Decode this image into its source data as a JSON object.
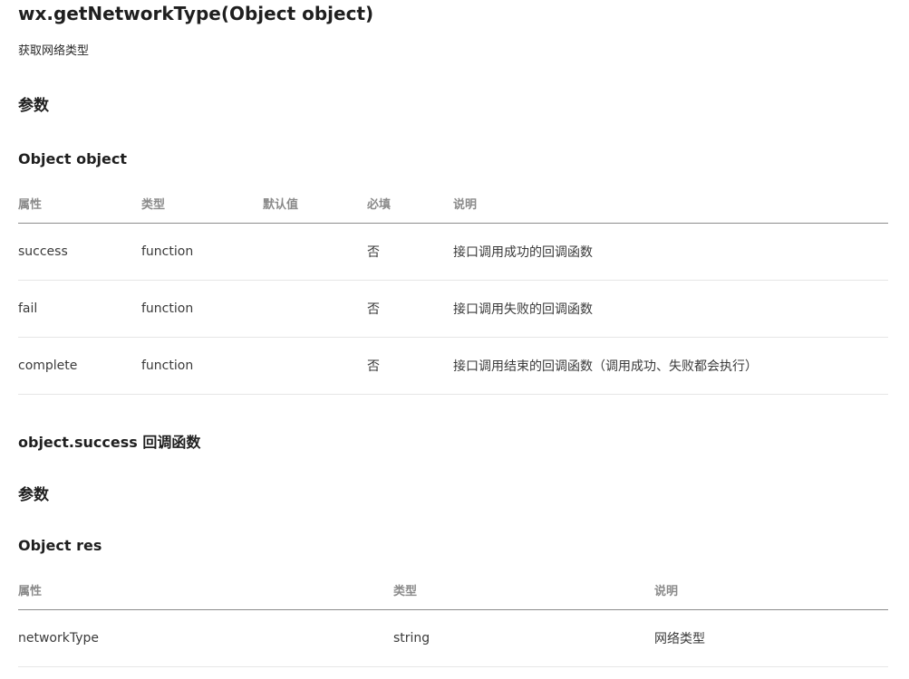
{
  "title": "wx.getNetworkType(Object object)",
  "description": "获取网络类型",
  "params_heading": "参数",
  "object_heading": "Object object",
  "object_table": {
    "headers": [
      "属性",
      "类型",
      "默认值",
      "必填",
      "说明"
    ],
    "rows": [
      {
        "name": "success",
        "type": "function",
        "default": "",
        "required": "否",
        "desc": "接口调用成功的回调函数"
      },
      {
        "name": "fail",
        "type": "function",
        "default": "",
        "required": "否",
        "desc": "接口调用失败的回调函数"
      },
      {
        "name": "complete",
        "type": "function",
        "default": "",
        "required": "否",
        "desc": "接口调用结束的回调函数（调用成功、失败都会执行）"
      }
    ]
  },
  "success_heading": "object.success 回调函数",
  "success_params_heading": "参数",
  "res_heading": "Object res",
  "res_table": {
    "headers": [
      "属性",
      "类型",
      "说明"
    ],
    "rows": [
      {
        "name": "networkType",
        "type": "string",
        "desc": "网络类型"
      }
    ]
  }
}
